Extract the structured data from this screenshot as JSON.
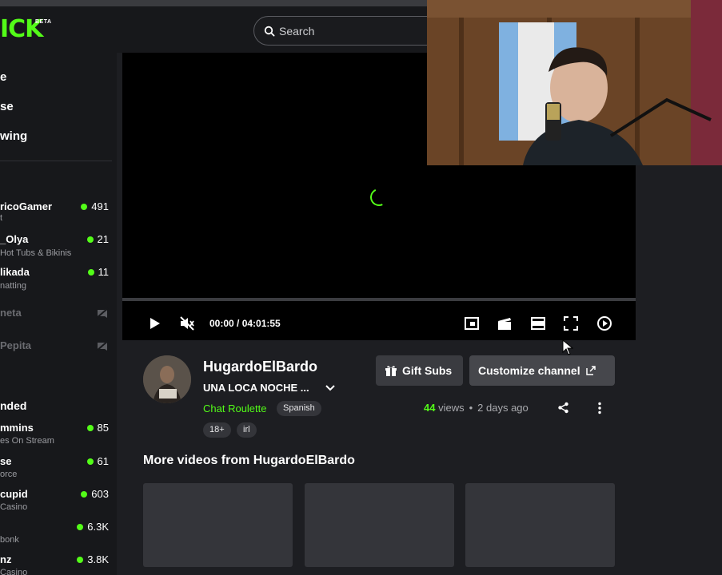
{
  "brand": {
    "logo_text": "ICK",
    "beta_label": "BETA",
    "accent": "#53fc18"
  },
  "search": {
    "placeholder": "Search"
  },
  "sidebar": {
    "nav": [
      "e",
      "se",
      "wing"
    ],
    "following": [
      {
        "name": "ricoGamer",
        "sub": "t",
        "viewers": "491",
        "live": true
      },
      {
        "name": "_Olya",
        "sub": "Hot Tubs & Bikinis",
        "viewers": "21",
        "live": true
      },
      {
        "name": "likada",
        "sub": "natting",
        "viewers": "11",
        "live": true
      },
      {
        "name": "neta",
        "sub": "",
        "viewers": "",
        "live": false
      },
      {
        "name": "Pepita",
        "sub": "",
        "viewers": "",
        "live": false
      }
    ],
    "recommended_title": "nded",
    "recommended": [
      {
        "name": "mmins",
        "sub": "es On Stream",
        "viewers": "85"
      },
      {
        "name": "se",
        "sub": "orce",
        "viewers": "61"
      },
      {
        "name": "cupid",
        "sub": "Casino",
        "viewers": "603"
      },
      {
        "name": "",
        "sub": "bonk",
        "viewers": "6.3K"
      },
      {
        "name": "nz",
        "sub": "Casino",
        "viewers": "3.8K"
      }
    ]
  },
  "player": {
    "time": "00:00 / 04:01:55",
    "progress": 0
  },
  "channel": {
    "name": "HugardoElBardo",
    "stream_title": "UNA LOCA NOCHE ...",
    "category": "Chat Roulette",
    "language": "Spanish",
    "tags": [
      "18+",
      "irl"
    ],
    "gift_subs_label": "Gift Subs",
    "customize_label": "Customize channel",
    "views_count": "44",
    "views_label": " views",
    "separator": "•",
    "posted": "2 days ago"
  },
  "more_videos": {
    "title": "More videos from HugardoElBardo",
    "count": 3
  }
}
